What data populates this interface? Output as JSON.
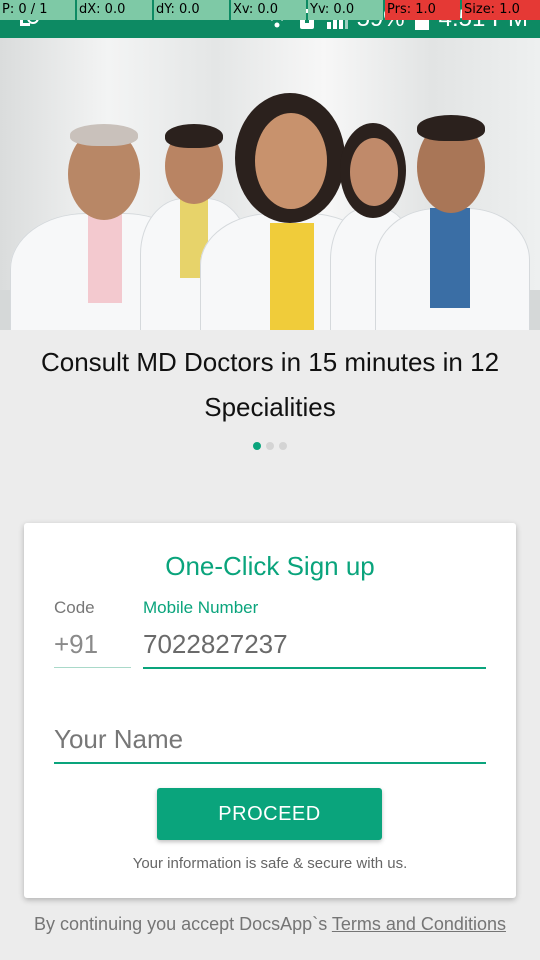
{
  "debug_bar": {
    "pointer": "P: 0 / 1",
    "dx": "dX: 0.0",
    "dy": "dY: 0.0",
    "xv": "Xv: 0.0",
    "yv": "Yv: 0.0",
    "prs": "Prs: 1.0",
    "size": "Size: 1.0"
  },
  "status_bar": {
    "battery": "59%",
    "time": "4:51 PM",
    "icons": [
      "notification-icon",
      "wifi-icon",
      "vibrate-icon",
      "signal-icon",
      "battery-icon"
    ]
  },
  "hero": {
    "tagline": "Consult MD Doctors in 15 minutes in 12 Specialities",
    "slide_count": 3,
    "active_slide": 0
  },
  "signup": {
    "title": "One-Click Sign up",
    "code_label": "Code",
    "mobile_label": "Mobile Number",
    "code_value": "+91",
    "mobile_value": "7022827237",
    "name_placeholder": "Your Name",
    "proceed_label": "PROCEED",
    "safe_note": "Your information is safe & secure with us."
  },
  "footer": {
    "prefix": "By continuing you accept DocsApp`s ",
    "terms_link": "Terms and Conditions"
  },
  "colors": {
    "accent": "#0aa47c",
    "status_bar": "#0d8a63"
  }
}
